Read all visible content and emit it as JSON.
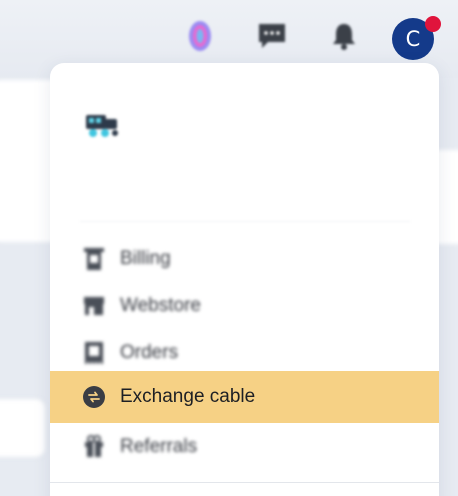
{
  "header": {
    "icons": {
      "coin": "coin-icon",
      "chat": "chat-icon",
      "bell": "bell-icon"
    },
    "avatar_initial": "C",
    "notification_color": "#e0143c",
    "avatar_color": "#143a8a"
  },
  "menu": {
    "logo_icon": "truck-icon",
    "items": [
      {
        "label": "Billing",
        "icon": "receipt-icon"
      },
      {
        "label": "Webstore",
        "icon": "store-icon"
      },
      {
        "label": "Orders",
        "icon": "orders-icon"
      },
      {
        "label": "Exchange cable",
        "icon": "exchange-icon",
        "active": true
      },
      {
        "label": "Referrals",
        "icon": "gift-icon"
      }
    ],
    "active_color": "#f6d185"
  }
}
